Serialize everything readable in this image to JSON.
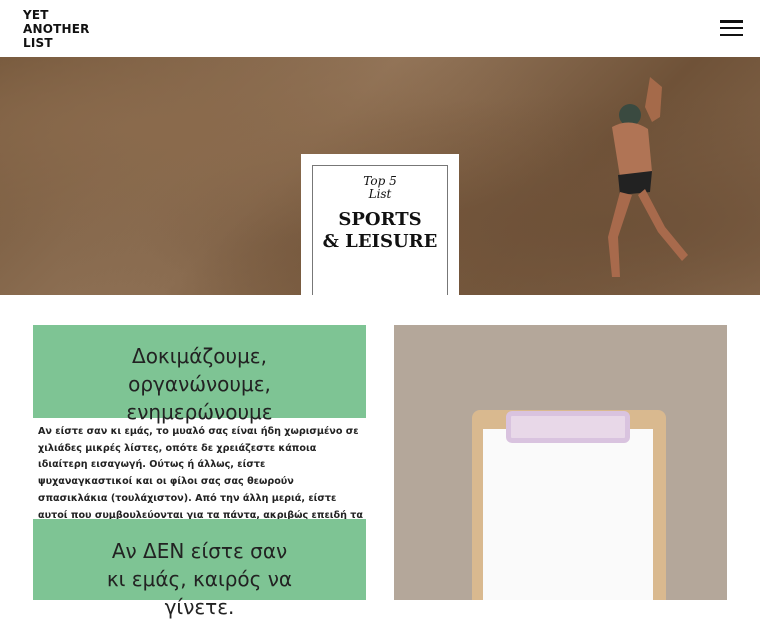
{
  "header": {
    "logo_lines": [
      "YET",
      "ANOTHER",
      "LIST"
    ],
    "menu_icon": "hamburger-icon"
  },
  "hero": {
    "card_subtitle_1": "Top 5",
    "card_subtitle_2": "List",
    "card_title_1": "SPORTS",
    "card_title_2": "& LEISURE",
    "slide_count": 8,
    "active_slide": 1
  },
  "section1": {
    "heading": "Δοκιμάζουμε, οργανώνουμε, ενημερώνουμε",
    "paragraph": "Αν είστε σαν κι εμάς, το μυαλό σας είναι ήδη χωρισμένο σε χιλιάδες μικρές λίστες, οπότε δε χρειάζεστε κάποια ιδιαίτερη εισαγωγή. Ούτως ή άλλως, είστε ψυχαναγκαστικοί και οι φίλοι σας σας θεωρούν σπασικλάκια (τουλάχιστον). Από την άλλη μεριά, είστε αυτοί που συμβουλεύονται για τα πάντα, ακριβώς επειδή τα έχετε όλα σορταρισμένα στο μυαλό σας."
  },
  "section2": {
    "heading": "Αν ΔΕΝ είστε σαν κι εμάς, καιρός να γίνετε."
  },
  "colors": {
    "green": "#7ec494",
    "photo_bg": "#b4a79a"
  }
}
